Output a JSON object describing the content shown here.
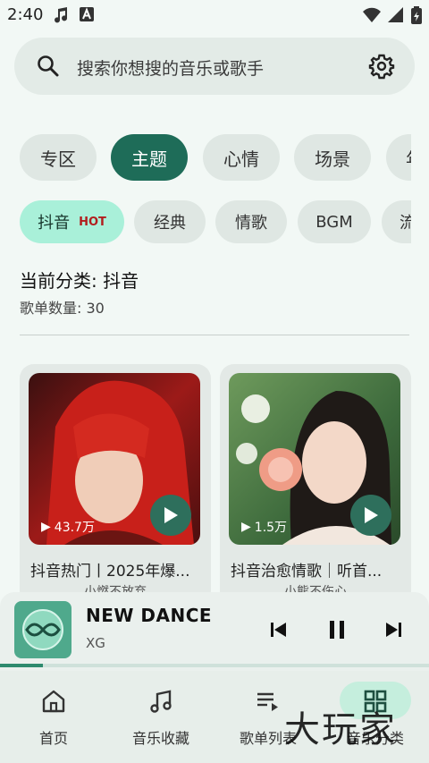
{
  "status": {
    "time": "2:40"
  },
  "search": {
    "placeholder": "搜索你想搜的音乐或歌手"
  },
  "primary_tabs": [
    "专区",
    "主题",
    "心情",
    "场景",
    "年"
  ],
  "primary_active": "主题",
  "secondary_tabs": [
    {
      "label": "抖音",
      "badge": "HOT"
    },
    {
      "label": "经典"
    },
    {
      "label": "情歌"
    },
    {
      "label": "BGM"
    },
    {
      "label": "流"
    }
  ],
  "secondary_active": "抖音",
  "category": {
    "title": "当前分类: 抖音",
    "count": "歌单数量: 30"
  },
  "cards": [
    {
      "play_count": "43.7万",
      "title": "抖音热门丨2025年爆...",
      "subtitle": "小燃不放弃"
    },
    {
      "play_count": "1.5万",
      "title": "抖音治愈情歌｜听首...",
      "subtitle": "小熊不伤心"
    }
  ],
  "now_playing": {
    "title": "NEW DANCE",
    "artist": "XG",
    "progress": 0.1
  },
  "bottom_nav": [
    "首页",
    "音乐收藏",
    "歌单列表",
    "音乐分类"
  ],
  "bottom_nav_active": "音乐分类",
  "watermark": "大玩家",
  "colors": {
    "accent": "#1e6c58",
    "chip_active_light": "#a9f0d9",
    "background": "#f2f8f5"
  }
}
